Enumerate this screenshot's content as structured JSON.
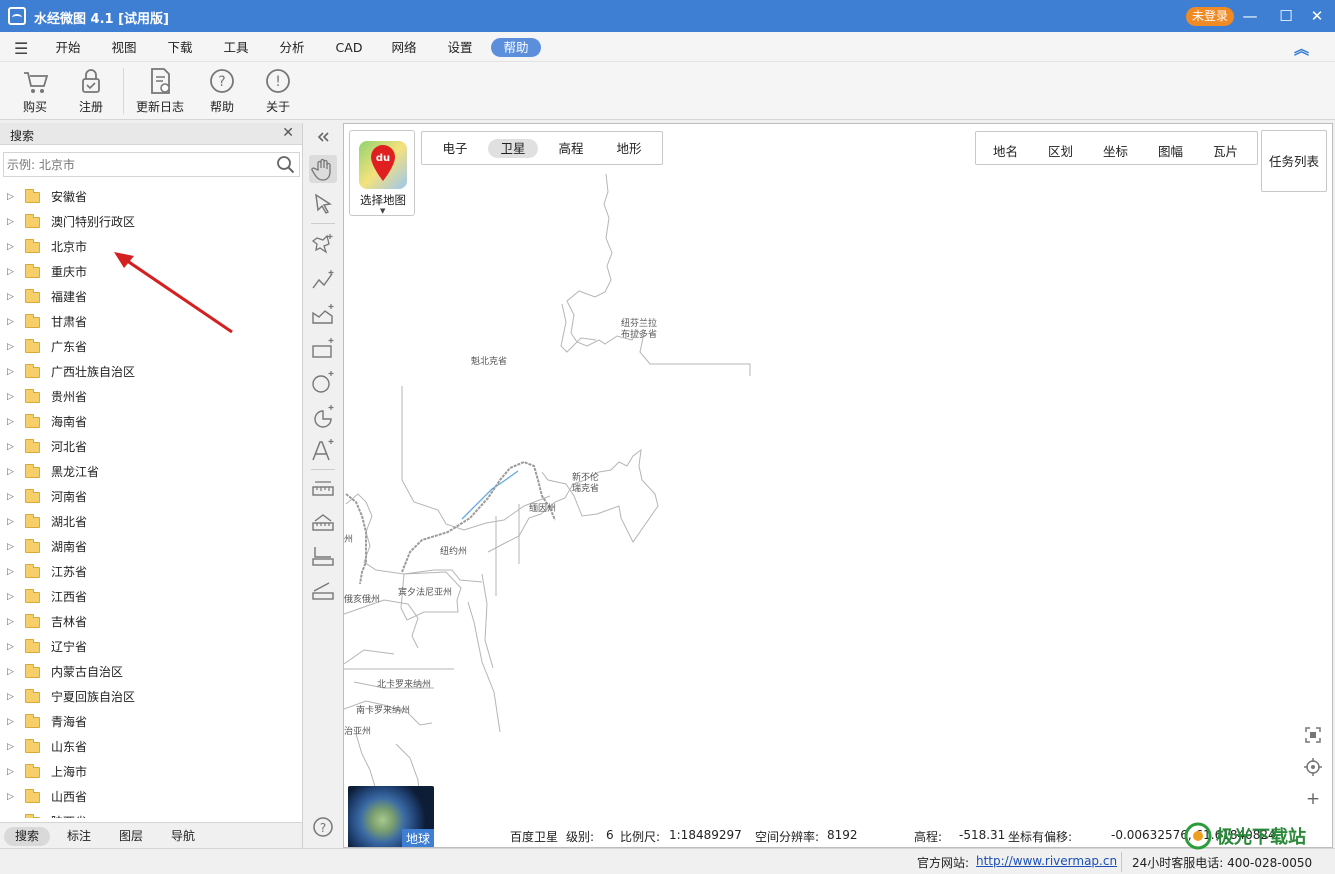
{
  "window": {
    "title": "水经微图 4.1 [试用版]",
    "login_label": "未登录",
    "minimize": "—",
    "maximize": "☐",
    "close": "✕"
  },
  "menu": {
    "items": [
      "开始",
      "视图",
      "下载",
      "工具",
      "分析",
      "CAD",
      "网络",
      "设置",
      "帮助"
    ],
    "active": "帮助"
  },
  "toolbar": {
    "buy": "购买",
    "register": "注册",
    "changelog": "更新日志",
    "help": "帮助",
    "about": "关于"
  },
  "left_panel": {
    "title": "搜索",
    "search_placeholder": "示例: 北京市",
    "tree_items": [
      "安徽省",
      "澳门特别行政区",
      "北京市",
      "重庆市",
      "福建省",
      "甘肃省",
      "广东省",
      "广西壮族自治区",
      "贵州省",
      "海南省",
      "河北省",
      "黑龙江省",
      "河南省",
      "湖北省",
      "湖南省",
      "江苏省",
      "江西省",
      "吉林省",
      "辽宁省",
      "内蒙古自治区",
      "宁夏回族自治区",
      "青海省",
      "山东省",
      "上海市",
      "山西省",
      "陕西省"
    ],
    "bottom_tabs": [
      "搜索",
      "标注",
      "图层",
      "导航"
    ],
    "active_tab": "搜索"
  },
  "map": {
    "select_map_label": "选择地图",
    "map_types": [
      "电子",
      "卫星",
      "高程",
      "地形"
    ],
    "active_map_type": "卫星",
    "tools": [
      "地名",
      "区划",
      "坐标",
      "图幅",
      "瓦片"
    ],
    "task_list": "任务列表",
    "globe_label": "地球",
    "labels": [
      "纽芬兰拉",
      "布拉多省",
      "魁北克省",
      "新不伦",
      "瑞克省",
      "缅因州",
      "纽约州",
      "宾夕法尼亚州",
      "俄亥俄州",
      "北卡罗来纳州",
      "南卡罗来纳州",
      "治亚州",
      "州"
    ],
    "status": {
      "source": "百度卫星",
      "level_label": "级别:",
      "level": "6",
      "scale_label": "比例尺:",
      "scale": "1:18489297",
      "resolution_label": "空间分辨率:",
      "resolution": "8192",
      "elevation_label": "高程:",
      "elevation": "-518.31",
      "offset_label": "坐标有偏移:",
      "coords": "-0.00632576, 61.61840824"
    }
  },
  "statusbar": {
    "site_label": "官方网站:",
    "site_url": "http://www.rivermap.cn",
    "phone": "24小时客服电话: 400-028-0050"
  },
  "watermark": "极光下载站",
  "colors": {
    "titlebar": "#3f7fd3",
    "login": "#f08a24",
    "arrow": "#d42020"
  }
}
